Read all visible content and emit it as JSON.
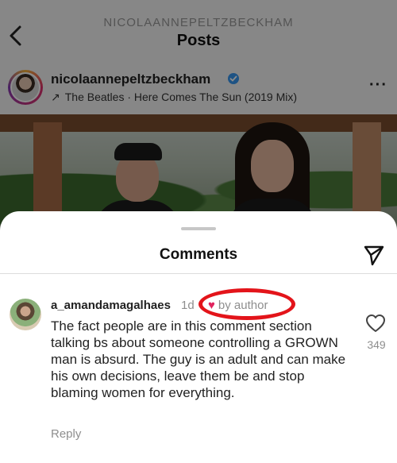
{
  "header": {
    "username": "NICOLAANNEPELTZBECKHAM",
    "title": "Posts"
  },
  "post": {
    "username": "nicolaannepeltzbeckham",
    "audio": "The Beatles · Here Comes The Sun (2019 Mix)",
    "audio_icon": "trending-arrow-icon",
    "more_icon": "more-dots-icon"
  },
  "comments_sheet": {
    "title": "Comments",
    "share_icon": "send-icon"
  },
  "comment": {
    "username": "a_amandamagalhaes",
    "time": "1d",
    "author_label": "by author",
    "author_heart": "♥",
    "text": "The fact people are in this comment section talking bs about someone controlling a GROWN man is absurd. The guy is an adult and can make his own decisions, leave them be and stop blaming women for everything.",
    "reply_label": "Reply",
    "like_count": "349",
    "highlight_color": "#e3141a",
    "heart_color": "#e0245e"
  }
}
